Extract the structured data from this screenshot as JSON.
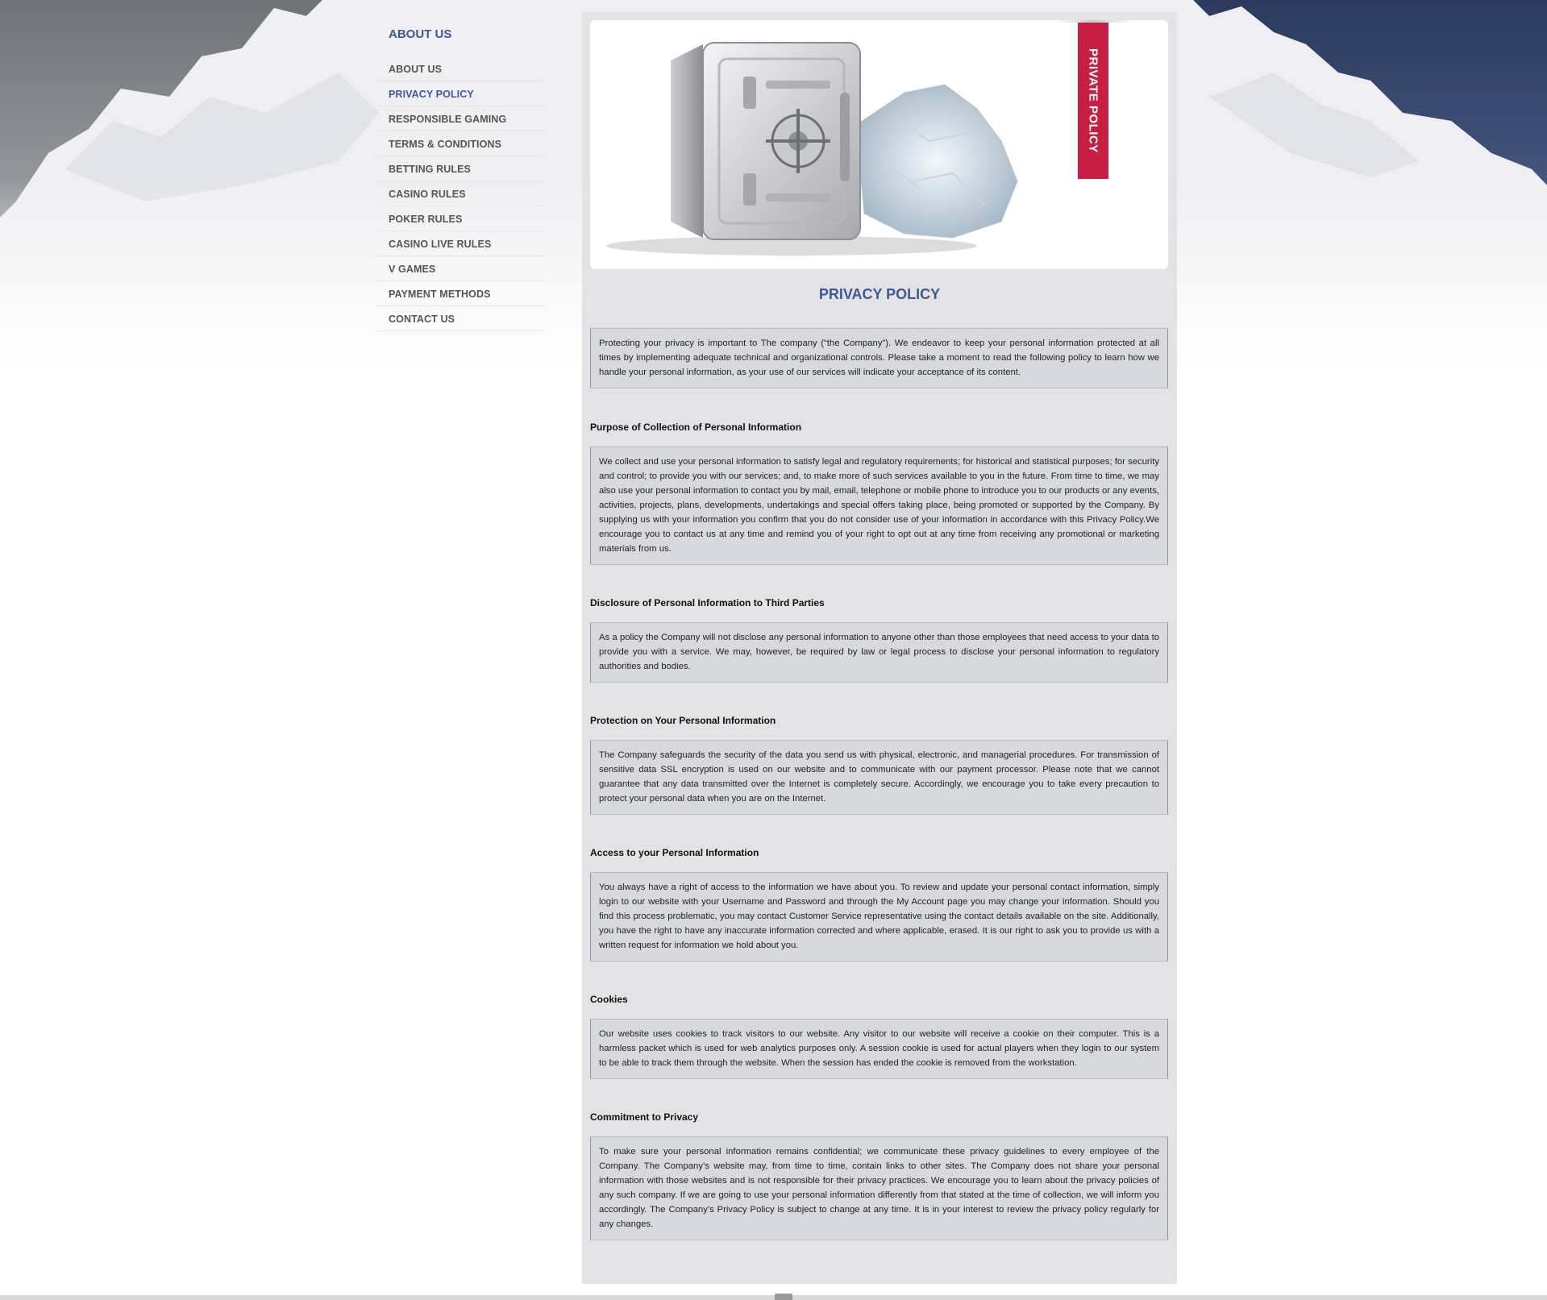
{
  "sidebar": {
    "title": "ABOUT US",
    "items": [
      {
        "label": "ABOUT US"
      },
      {
        "label": "PRIVACY POLICY",
        "active": true
      },
      {
        "label": "RESPONSIBLE GAMING"
      },
      {
        "label": "TERMS & CONDITIONS"
      },
      {
        "label": "BETTING RULES"
      },
      {
        "label": "CASINO RULES"
      },
      {
        "label": "POKER RULES"
      },
      {
        "label": "CASINO LIVE RULES"
      },
      {
        "label": "V GAMES"
      },
      {
        "label": "PAYMENT METHODS"
      },
      {
        "label": "CONTACT US"
      }
    ]
  },
  "hero": {
    "ribbon_text": "PRIVATE POLICY",
    "image_icon": "vault-safe-with-ice-icon"
  },
  "main": {
    "title": "PRIVACY POLICY",
    "intro": "Protecting your privacy is important to The company (“the Company”). We endeavor to keep your personal information protected at all times by implementing adequate technical and organizational controls. Please take a moment to read the following policy to learn how we handle your personal information, as your use of our services will indicate your acceptance of its content.",
    "sections": [
      {
        "heading": "Purpose of Collection of Personal Information",
        "body": "We collect and use your personal information to satisfy legal and regulatory requirements; for historical and statistical purposes; for security and control; to provide you with our services; and, to make more of such services available to you in the future. From time to time, we may also use your personal information to contact you by mail, email, telephone or mobile phone to introduce you to our products or any events, activities, projects, plans, developments, undertakings and special offers taking place, being promoted or supported by the Company. By supplying us with your information you confirm that you do not consider use of your information in accordance with this Privacy Policy.We encourage you to contact us at any time and remind you of your right to opt out at any time from receiving any promotional or marketing materials from us."
      },
      {
        "heading": "Disclosure of Personal Information to Third Parties",
        "body": "As a policy the Company will not disclose any personal information to anyone other than those employees that need access to your data to provide you with a service. We may, however, be required by law or legal process to disclose your personal information to regulatory authorities and bodies."
      },
      {
        "heading": "Protection on Your Personal Information",
        "body": "The Company safeguards the security of the data you send us with physical, electronic, and managerial procedures. For transmission of sensitive data SSL encryption is used on our website and to communicate with our payment processor. Please note that we cannot guarantee that any data transmitted over the Internet is completely secure. Accordingly, we encourage you to take every precaution to protect your personal data when you are on the Internet."
      },
      {
        "heading": "Access to your Personal Information",
        "body": "You always have a right of access to the information we have about you. To review and update your personal contact information, simply login to our website with your Username and Password and through the My Account page you may change your information. Should you find this process problematic, you may contact Customer Service representative using the contact details available on the site. Additionally, you have the right to have any inaccurate information corrected and where applicable, erased. It is our right to ask you to provide us with a written request for information we hold about you."
      },
      {
        "heading": "Cookies",
        "body": "Our website uses cookies to track visitors to our website. Any visitor to our website will receive a cookie on their computer. This is a harmless packet which is used for web analytics purposes only. A session cookie is used for actual players when they login to our system to be able to track them through the website. When the session has ended the cookie is removed from the workstation."
      },
      {
        "heading": "Commitment to Privacy",
        "body": "To make sure your personal information remains confidential; we communicate these privacy guidelines to every employee of the Company. The Company’s website may, from time to time, contain links to other sites. The Company does not share your personal information with those websites and is not responsible for their privacy practices. We encourage you to learn about the privacy policies of any such company. If we are going to use your personal information differently from that stated at the time of collection, we will inform you accordingly. The Company’s Privacy Policy is subject to change at any time. It is in your interest to review the privacy policy regularly for any changes."
      }
    ]
  },
  "colors": {
    "accent": "#3b5994",
    "ribbon": "#c81e42",
    "panel": "#e3e3e5",
    "box": "#d8d9de"
  }
}
